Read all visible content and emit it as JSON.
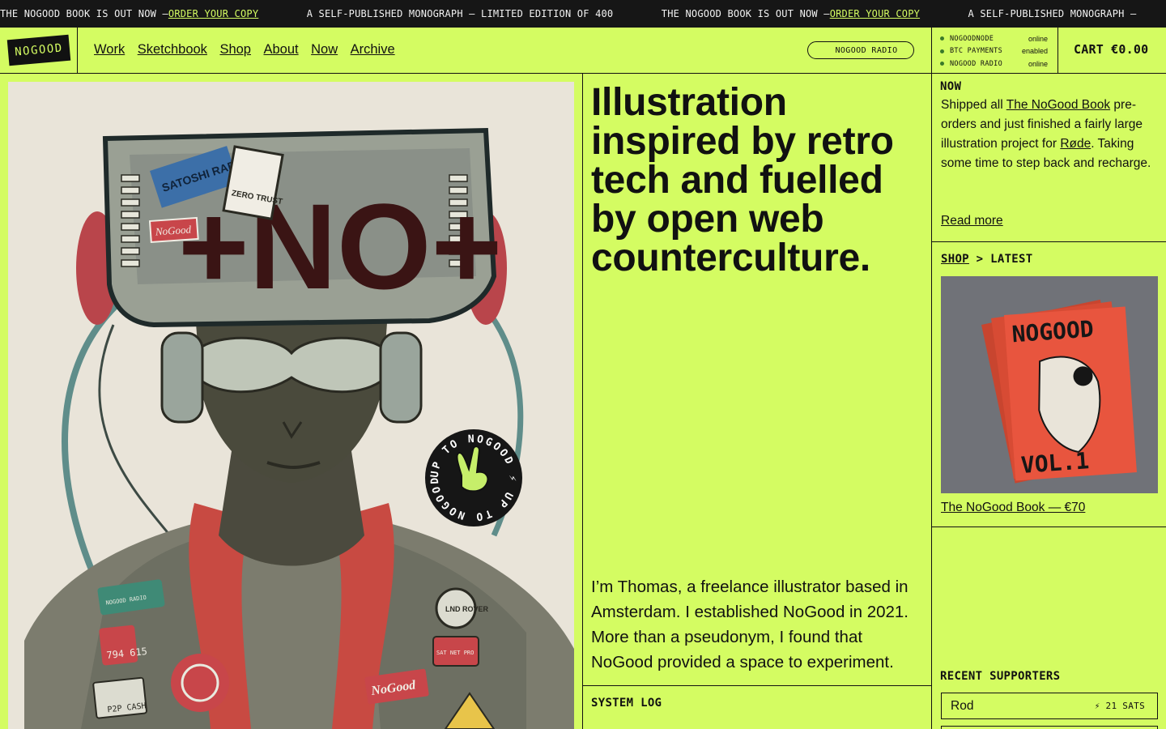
{
  "ticker": {
    "items": [
      {
        "text": "THE NOGOOD BOOK IS OUT NOW — ",
        "link": "ORDER YOUR COPY"
      },
      {
        "text": "A SELF-PUBLISHED MONOGRAPH — LIMITED EDITION OF 400",
        "link": ""
      },
      {
        "text": "THE NOGOOD BOOK IS OUT NOW — ",
        "link": "ORDER YOUR COPY"
      },
      {
        "text": "A SELF-PUBLISHED MONOGRAPH —",
        "link": ""
      }
    ]
  },
  "header": {
    "logo": "NOGOOD",
    "nav": [
      "Work",
      "Sketchbook",
      "Shop",
      "About",
      "Now",
      "Archive"
    ],
    "radio_button": "NOGOOD RADIO",
    "status": [
      {
        "name": "NOGOODNODE",
        "value": "online"
      },
      {
        "name": "BTC PAYMENTS",
        "value": "enabled"
      },
      {
        "name": "NOGOOD RADIO",
        "value": "online"
      }
    ],
    "cart": "CART €0.00"
  },
  "hero": {
    "badge_text": "UP TO NOGOOD ⚡ UP TO NOGOOD ⚡",
    "visor_sticker_1": "SATOSHI RADIO",
    "visor_sticker_2": "ZERO TRUST",
    "visor_sticker_3": "NoGood",
    "visor_mark": "+NO+",
    "patch_1": "794 615",
    "patch_2": "P2P CASH",
    "patch_3": "NoGood",
    "patch_4": "LND ROVER",
    "patch_5": "SAT NET PRO",
    "patch_6": "NOGOOD RADIO"
  },
  "intro": {
    "tagline": "Illustration inspired by retro tech and fuelled by open web counterculture.",
    "bio": "I’m Thomas, a freelance illustrator based in Amsterdam. I established NoGood in 2021. More than a pseudonym, I found that NoGood provided a space to experiment.",
    "system_log": "SYSTEM LOG"
  },
  "now": {
    "title": "NOW",
    "text_1": "Shipped all ",
    "link_1": "The NoGood Book",
    "text_2": " pre-orders and just finished a fairly large illustration project for ",
    "link_2": "Røde",
    "text_3": ". Taking some time to step back and recharge.",
    "read_more": "Read more"
  },
  "shop": {
    "link": "SHOP",
    "suffix": " > LATEST",
    "cover_title": "NOGOOD",
    "cover_vol": "VOL.1",
    "caption": "The NoGood Book — €70"
  },
  "supporters": {
    "title": "RECENT SUPPORTERS",
    "list": [
      {
        "name": "Rod",
        "sats": "⚡ 21 SATS"
      }
    ]
  },
  "colors": {
    "accent": "#d4fc62",
    "ink": "#111111",
    "status_dot": "#3a7a2a",
    "badge": "#161616",
    "book": "#e8553e"
  }
}
